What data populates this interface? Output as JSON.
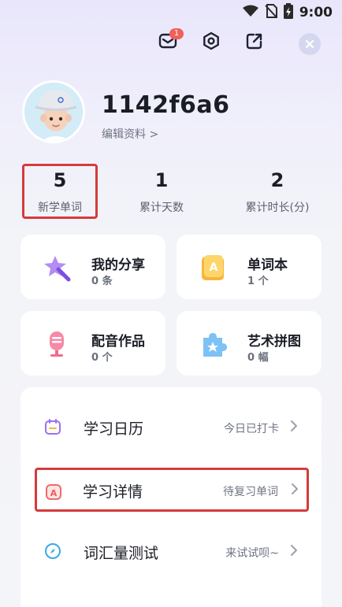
{
  "status_bar": {
    "time": "9:00",
    "icons": [
      "wifi-icon",
      "no-sim-icon",
      "battery-charging-icon"
    ]
  },
  "top_actions": {
    "message_badge": "1",
    "icons": [
      "mail-icon",
      "settings-icon",
      "share-icon",
      "close-icon"
    ]
  },
  "profile": {
    "username": "1142f6a6",
    "edit_label": "编辑资料 >"
  },
  "stats": [
    {
      "value": "5",
      "label": "新学单词"
    },
    {
      "value": "1",
      "label": "累计天数"
    },
    {
      "value": "2",
      "label": "累计时长(分)"
    }
  ],
  "cards": [
    {
      "title": "我的分享",
      "sub": "0 条",
      "icon": "star-wand-icon"
    },
    {
      "title": "单词本",
      "sub": "1 个",
      "icon": "word-book-icon"
    },
    {
      "title": "配音作品",
      "sub": "0 个",
      "icon": "microphone-icon"
    },
    {
      "title": "艺术拼图",
      "sub": "0 幅",
      "icon": "puzzle-icon"
    }
  ],
  "menu": [
    {
      "label": "学习日历",
      "right": "今日已打卡",
      "icon": "calendar-icon"
    },
    {
      "label": "学习详情",
      "right": "待复习单词",
      "icon": "study-detail-icon"
    },
    {
      "label": "词汇量测试",
      "right": "来试试呗~",
      "icon": "vocab-test-icon"
    }
  ],
  "colors": {
    "highlight": "#d43b3b",
    "badge": "#f0605a",
    "accent_purple": "#8a5cf0"
  }
}
